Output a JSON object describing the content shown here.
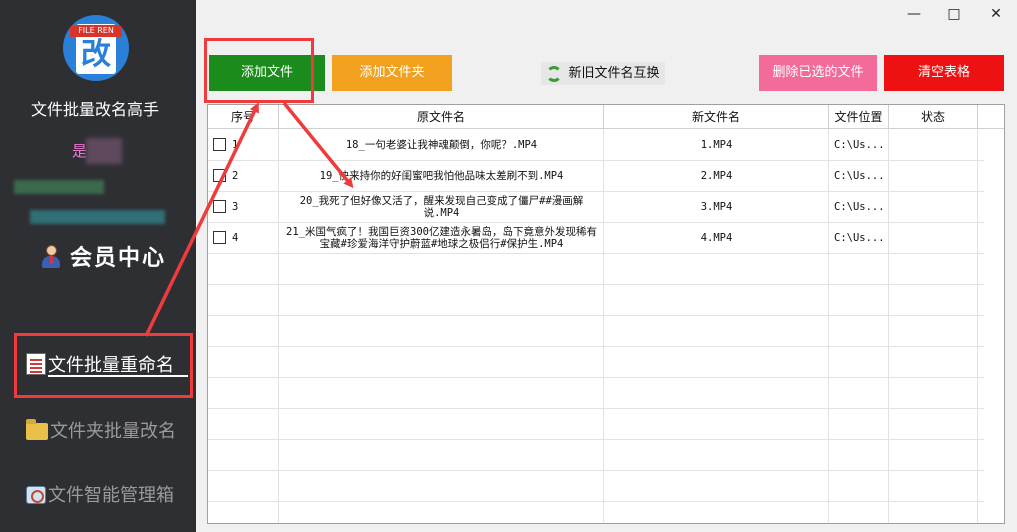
{
  "app": {
    "title": "文件批量改名高手",
    "logo_ribbon": "FILE REN",
    "logo_glyph": "改",
    "user_char": "是",
    "member_center": "会员中心"
  },
  "nav": {
    "rename": "文件批量重命名",
    "folder": "文件夹批量改名",
    "tools": "文件智能管理箱"
  },
  "window": {
    "minimize": "—",
    "maximize": "□",
    "close": "✕"
  },
  "toolbar": {
    "add_file": "添加文件",
    "add_folder": "添加文件夹",
    "swap_names": "新旧文件名互换",
    "delete_selected": "删除已选的文件",
    "clear_table": "清空表格"
  },
  "table": {
    "headers": {
      "index": "序号",
      "old_name": "原文件名",
      "new_name": "新文件名",
      "location": "文件位置",
      "status": "状态"
    },
    "rows": [
      {
        "index": "1",
        "old_name": "18_一句老婆让我神魂颠倒，你呢？.MP4",
        "new_name": "1.MP4",
        "location": "C:\\Us...",
        "status": ""
      },
      {
        "index": "2",
        "old_name": "19_快来持你的好闺蜜吧我怕他品味太差刷不到.MP4",
        "new_name": "2.MP4",
        "location": "C:\\Us...",
        "status": ""
      },
      {
        "index": "3",
        "old_name": "20_我死了但好像又活了，醒来发现自己变成了僵尸##漫画解说.MP4",
        "new_name": "3.MP4",
        "location": "C:\\Us...",
        "status": ""
      },
      {
        "index": "4",
        "old_name": "21_米国气疯了！我国巨资300亿建造永暑岛，岛下竟意外发现稀有宝藏#珍爱海洋守护蔚蓝#地球之极侣行#保护生.MP4",
        "new_name": "4.MP4",
        "location": "C:\\Us...",
        "status": ""
      }
    ]
  },
  "colors": {
    "sidebar_bg": "#2e2f33",
    "add_file": "#1b8c1b",
    "add_folder": "#f2a11f",
    "delete_selected": "#f26b9a",
    "clear_table": "#ee1111",
    "annotation": "#ef3b3b"
  }
}
